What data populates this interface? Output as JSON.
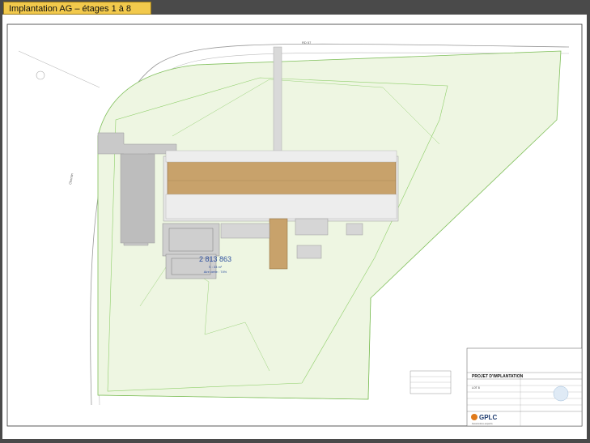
{
  "slide_title": "Implantation AG – étages 1 à 8",
  "plan": {
    "top_road_label": "RD 57",
    "left_road_label": "Chemin",
    "parcel_number": "2 813 863",
    "parcel_area": "S : 33 m²",
    "parcel_note": "Aire verte : 74%"
  },
  "title_block": {
    "project_heading": "PROJET D'IMPLANTATION",
    "lot_value": "LOT 8",
    "logo_text": "GPLC",
    "logo_subtext": "Géomètres-experts"
  },
  "colors": {
    "sheet": "#ffffff",
    "frame": "#4a4a4a",
    "tab": "#f2c94c",
    "green_area": "#eef6e2",
    "green_line": "#7fbf5a",
    "building": "#c8a26b",
    "gray": "#b5b5b5",
    "blue_text": "#2c4f9e"
  }
}
